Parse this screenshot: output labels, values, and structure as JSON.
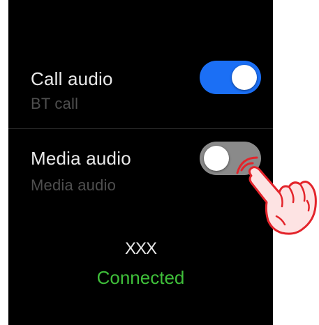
{
  "settings": {
    "call_audio": {
      "title": "Call audio",
      "subtitle": "BT call",
      "enabled": true
    },
    "media_audio": {
      "title": "Media audio",
      "subtitle": "Media audio",
      "enabled": false
    }
  },
  "device": {
    "name": "XXX",
    "status": "Connected"
  },
  "colors": {
    "toggle_on": "#1b6ff5",
    "toggle_off": "#8a8a8a",
    "status_green": "#3fbf3a",
    "hand_outline": "#e3242b",
    "hand_fill": "#fde3e3"
  },
  "icons": {
    "pointer": "tapping-hand-icon"
  }
}
